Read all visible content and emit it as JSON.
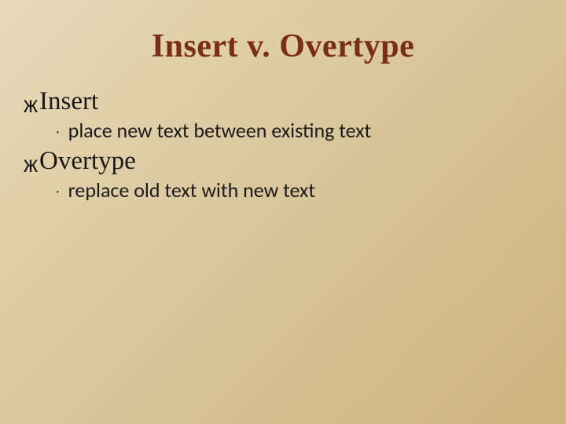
{
  "title": "Insert v. Overtype",
  "items": [
    {
      "heading": "Insert",
      "sub": "place new text between existing text"
    },
    {
      "heading": "Overtype",
      "sub": "replace old text with new text"
    }
  ]
}
